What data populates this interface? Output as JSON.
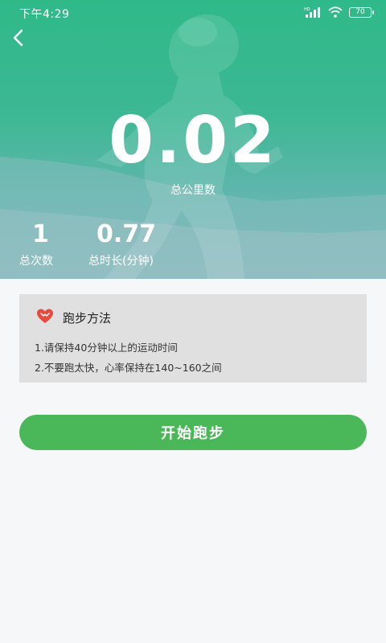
{
  "status_bar": {
    "time": "下午4:29",
    "network_label": "HD",
    "battery": "70"
  },
  "header": {
    "back_icon": "chevron-left-icon"
  },
  "summary": {
    "total_distance": "0.02",
    "total_distance_label": "总公里数",
    "total_count": "1",
    "total_count_label": "总次数",
    "total_duration": "0.77",
    "total_duration_label": "总时长(分钟)"
  },
  "method": {
    "icon": "heart-icon",
    "title": "跑步方法",
    "tips": [
      "1.请保持40分钟以上的运动时间",
      "2.不要跑太快，心率保持在140~160之间"
    ]
  },
  "actions": {
    "start_label": "开始跑步"
  },
  "colors": {
    "hero": "#35b88c",
    "card": "#e0e0e0",
    "button": "#4ab758",
    "heart": "#e84a3f"
  }
}
